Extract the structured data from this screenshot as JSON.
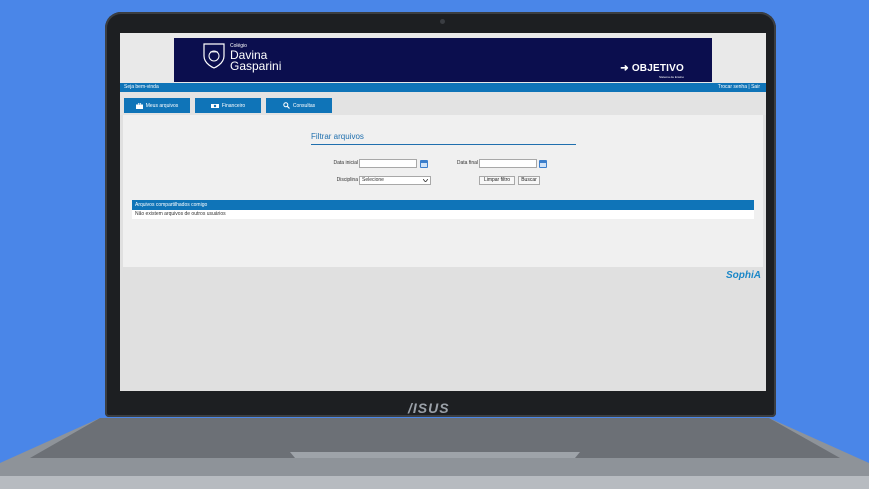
{
  "banner": {
    "school_prefix": "Colégio",
    "school_name_line1": "Davina",
    "school_name_line2": "Gasparini",
    "partner_logo": "OBJETIVO",
    "partner_sub": "Sistema de Ensino"
  },
  "topbar": {
    "welcome": "Seja bem-vinda",
    "change_password": "Trocar senha",
    "separator": "|",
    "logout": "Sair"
  },
  "tabs": [
    {
      "label": "Meus arquivos",
      "icon": "briefcase-icon"
    },
    {
      "label": "Financeiro",
      "icon": "money-icon"
    },
    {
      "label": "Consultas",
      "icon": "search-icon"
    }
  ],
  "filter": {
    "title": "Filtrar arquivos",
    "start_date_label": "Data inicial",
    "start_date_value": "",
    "end_date_label": "Data final",
    "end_date_value": "",
    "subject_label": "Disciplina",
    "subject_selected": "Selecione",
    "clear_button": "Limpar filtro",
    "search_button": "Buscar"
  },
  "shared_table": {
    "header": "Arquivos compartilhados comigo",
    "empty_message": "Não existem arquivos de outros usuários"
  },
  "footer_brand": "SophiA",
  "device_brand": "/ISUS",
  "colors": {
    "accent": "#0f74b8",
    "banner_bg": "#0b0e4e",
    "background": "#4a86e8"
  }
}
